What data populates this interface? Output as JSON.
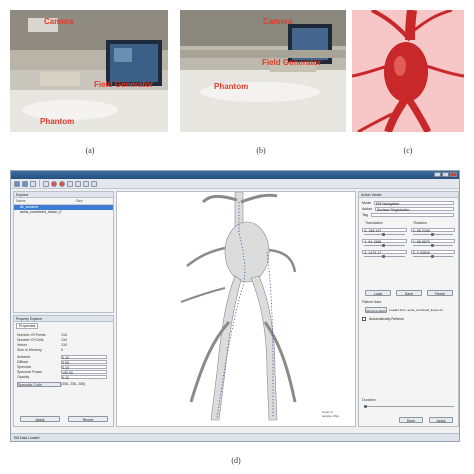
{
  "photos": {
    "a": {
      "labels": {
        "cam": "Camera",
        "field": "Field Generator",
        "phantom": "Phantom"
      },
      "caption": "(a)"
    },
    "b": {
      "labels": {
        "cam": "Camera",
        "field": "Field Generator",
        "phantom": "Phantom"
      },
      "caption": "(b)"
    },
    "c": {
      "caption": "(c)"
    }
  },
  "caption_d": "(d)",
  "app": {
    "explorer": {
      "title": "Explorer",
      "col_name": "Name",
      "col_size": "Size",
      "items": [
        "lib_isolated",
        "aorta_combined_fusion_0"
      ]
    },
    "properties": {
      "title": "Property Explorer",
      "tab": "Properties",
      "rows": [
        {
          "k": "Number Of Points",
          "v": "134"
        },
        {
          "k": "Number Of Cells",
          "v": "134"
        },
        {
          "k": "Vertex",
          "v": "134"
        },
        {
          "k": "Size in Memory",
          "v": "0"
        }
      ],
      "inputs": [
        {
          "k": "Ambient",
          "v": "0.10"
        },
        {
          "k": "Diffuse",
          "v": "0.90"
        },
        {
          "k": "Specular",
          "v": "0.10"
        },
        {
          "k": "Specular Power",
          "v": "100.00"
        },
        {
          "k": "Opacity",
          "v": "0.10"
        }
      ],
      "specular_color_label": "Specular Color",
      "specular_color_value": "(255, 255, 255)",
      "apply": "Apply",
      "reset": "Revert"
    },
    "viewport": {
      "stats_line1": "Count:0",
      "stats_line2": "sample: 0fps"
    },
    "action": {
      "title": "Action Viewer",
      "mode_label": "Mode",
      "mode_value": "EM Navigation",
      "action_label": "Action",
      "action_value": "Surface Registration",
      "tag_label": "Tag",
      "translation": "Translation",
      "rotation": "Rotation",
      "tx": [
        "X: 185.197",
        "Y: 94.1588",
        "Z: 1470.17"
      ],
      "rx": [
        "X: 85.2266",
        "Y: 88.8679",
        "Z: 0.33828"
      ],
      "load": "Load",
      "save": "Save",
      "reset": "Reset",
      "patient_data": "Patient data",
      "patient_btn": "Retrieve Mesh",
      "loaded_from": "Loaded from: aorta_combined_fusion.stl",
      "auto_refresh": "Automatically Refresh",
      "duration": "Duration",
      "done": "Done",
      "apply": "Apply"
    },
    "status": "EM Data Loaded"
  },
  "colors": {
    "camera_label": "#e03a2a",
    "aorta_red": "#c8282a",
    "title_blue": "#2e6aa6",
    "selection_blue": "#3d7bd4"
  }
}
